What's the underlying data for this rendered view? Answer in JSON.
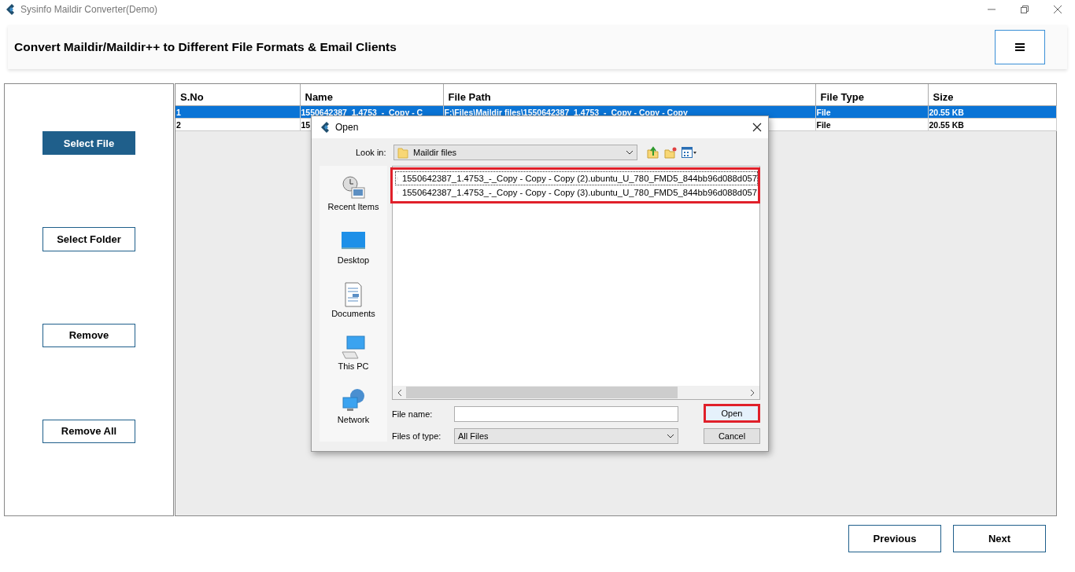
{
  "window": {
    "title": "Sysinfo Maildir Converter(Demo)"
  },
  "header": {
    "title": "Convert Maildir/Maildir++ to Different File Formats & Email Clients"
  },
  "sidebar": {
    "buttons": [
      {
        "label": "Select File",
        "selected": true
      },
      {
        "label": "Select Folder",
        "selected": false
      },
      {
        "label": "Remove",
        "selected": false
      },
      {
        "label": "Remove All",
        "selected": false
      }
    ]
  },
  "table": {
    "columns": [
      "S.No",
      "Name",
      "File Path",
      "File Type",
      "Size"
    ],
    "rows": [
      {
        "sno": "1",
        "name": "1550642387_1.4753_-_Copy - C",
        "file_path": "F:\\Files\\Maildir files\\1550642387_1.4753_-_Copy - Copy - Copy",
        "file_type": "File",
        "size": "20.55 KB",
        "selected": true
      },
      {
        "sno": "2",
        "name": "15",
        "file_type": "File",
        "size": "20.55 KB",
        "selected": false
      }
    ]
  },
  "dialog": {
    "title": "Open",
    "look_in_label": "Look in:",
    "look_in": "Maildir files",
    "places": [
      {
        "kind": "recent",
        "label": "Recent Items"
      },
      {
        "kind": "desktop",
        "label": "Desktop"
      },
      {
        "kind": "documents",
        "label": "Documents"
      },
      {
        "kind": "computer",
        "label": "This PC"
      },
      {
        "kind": "network",
        "label": "Network"
      }
    ],
    "files_highlighted": true,
    "files": [
      {
        "name": "1550642387_1.4753_-_Copy - Copy - Copy (2).ubuntu_U_780_FMD5_844bb96d088d057",
        "focused": true
      },
      {
        "name": "1550642387_1.4753_-_Copy - Copy - Copy (3).ubuntu_U_780_FMD5_844bb96d088d057",
        "focused": false
      }
    ],
    "file_name_label": "File name:",
    "files_of_type_label": "Files of type:",
    "files_of_type": "All Files",
    "buttons": [
      {
        "label": "Open",
        "highlighted": true
      },
      {
        "label": "Cancel",
        "highlighted": false
      }
    ]
  },
  "footer": {
    "buttons": [
      "Previous",
      "Next"
    ]
  }
}
